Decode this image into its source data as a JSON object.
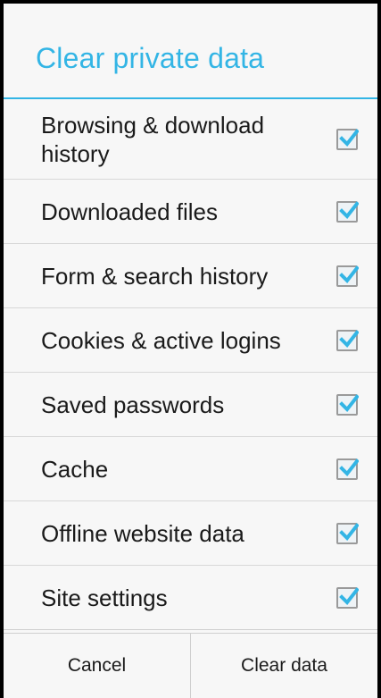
{
  "dialog": {
    "title": "Clear private data",
    "accent_color": "#33b5e5",
    "items": [
      {
        "label": "Browsing & download history",
        "checked": true
      },
      {
        "label": "Downloaded files",
        "checked": true
      },
      {
        "label": "Form & search history",
        "checked": true
      },
      {
        "label": "Cookies & active logins",
        "checked": true
      },
      {
        "label": "Saved passwords",
        "checked": true
      },
      {
        "label": "Cache",
        "checked": true
      },
      {
        "label": "Offline website data",
        "checked": true
      },
      {
        "label": "Site settings",
        "checked": true
      }
    ],
    "buttons": {
      "cancel": "Cancel",
      "clear": "Clear data"
    }
  }
}
